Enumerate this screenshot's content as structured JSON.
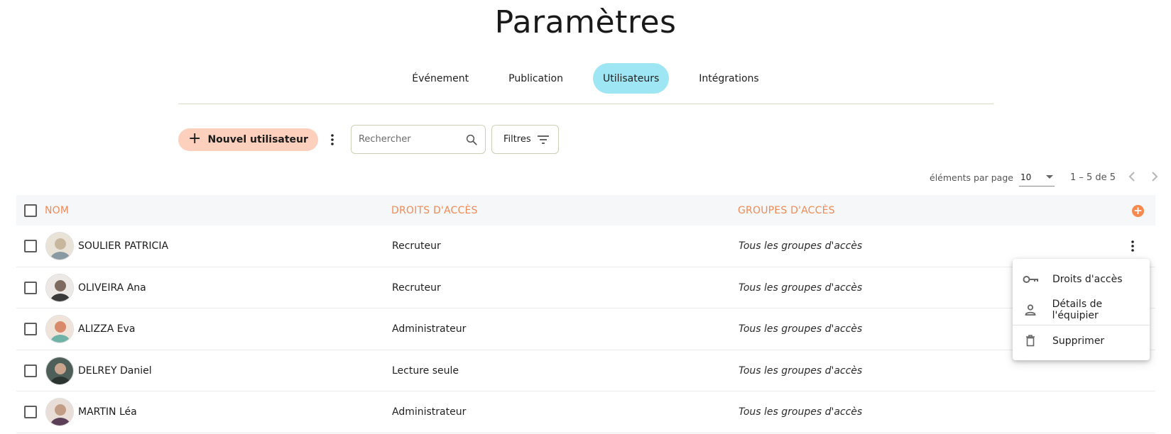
{
  "page": {
    "title": "Paramètres"
  },
  "tabs": [
    {
      "label": "Événement",
      "active": false
    },
    {
      "label": "Publication",
      "active": false
    },
    {
      "label": "Utilisateurs",
      "active": true
    },
    {
      "label": "Intégrations",
      "active": false
    }
  ],
  "toolbar": {
    "new_user_label": "Nouvel utilisateur",
    "search_placeholder": "Rechercher",
    "search_value": "",
    "filters_label": "Filtres"
  },
  "pagination": {
    "per_page_label": "éléments par page",
    "per_page_value": "10",
    "range_label": "1 – 5 de 5"
  },
  "table": {
    "columns": {
      "name": "NOM",
      "rights": "DROITS D'ACCÈS",
      "groups": "GROUPES D'ACCÈS"
    },
    "rows": [
      {
        "name": "SOULIER PATRICIA",
        "rights": "Recruteur",
        "groups": "Tous les groupes d'accès",
        "avatar_color": "#c9b79d"
      },
      {
        "name": "OLIVEIRA Ana",
        "rights": "Recruteur",
        "groups": "Tous les groupes d'accès",
        "avatar_color": "#7e6a5f"
      },
      {
        "name": "ALIZZA Eva",
        "rights": "Administrateur",
        "groups": "Tous les groupes d'accès",
        "avatar_color": "#d98a6a"
      },
      {
        "name": "DELREY Daniel",
        "rights": "Lecture seule",
        "groups": "Tous les groupes d'accès",
        "avatar_color": "#3f4f4a"
      },
      {
        "name": "MARTIN Léa",
        "rights": "Administrateur",
        "groups": "Tous les groupes d'accès",
        "avatar_color": "#c39c86"
      }
    ]
  },
  "context_menu": {
    "items": [
      {
        "label": "Droits d'accès",
        "icon": "key-icon"
      },
      {
        "label": "Détails de l'équipier",
        "icon": "person-icon"
      },
      {
        "label": "Supprimer",
        "icon": "trash-icon"
      }
    ]
  },
  "colors": {
    "accent_orange": "#f08a55",
    "active_tab": "#9fe6f4",
    "new_button": "#fcd0bc"
  }
}
